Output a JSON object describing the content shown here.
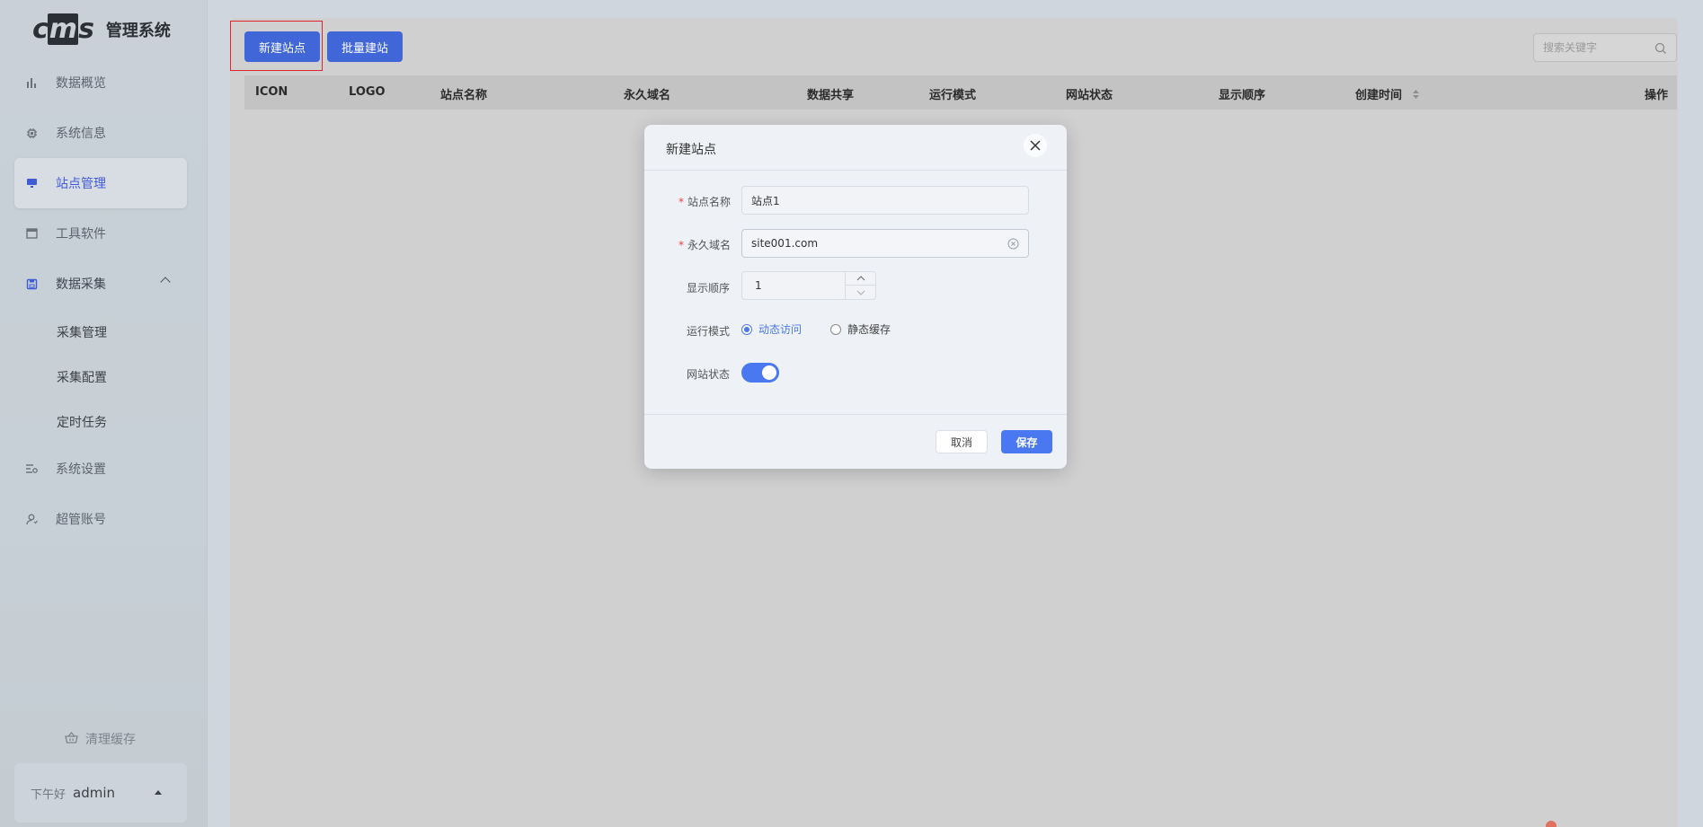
{
  "app": {
    "logo_text": "cms",
    "title": "管理系统"
  },
  "sidebar": {
    "items": [
      {
        "label": "数据概览",
        "icon": "bar-chart-icon"
      },
      {
        "label": "系统信息",
        "icon": "chip-icon"
      },
      {
        "label": "站点管理",
        "icon": "monitor-icon",
        "active": true
      },
      {
        "label": "工具软件",
        "icon": "window-icon"
      },
      {
        "label": "数据采集",
        "icon": "save-icon",
        "expanded": true
      }
    ],
    "sub_items": [
      "采集管理",
      "采集配置",
      "定时任务"
    ],
    "bottom_items": [
      {
        "label": "系统设置",
        "icon": "settings-list-icon"
      },
      {
        "label": "超管账号",
        "icon": "user-icon"
      }
    ],
    "clear_cache": "清理缓存",
    "greeting": "下午好",
    "username": "admin"
  },
  "toolbar": {
    "new_site": "新建站点",
    "batch_create": "批量建站",
    "search_placeholder": "搜索关键字"
  },
  "table": {
    "columns": [
      "ICON",
      "LOGO",
      "站点名称",
      "永久域名",
      "数据共享",
      "运行模式",
      "网站状态",
      "显示顺序",
      "创建时间",
      "操作"
    ]
  },
  "modal": {
    "title": "新建站点",
    "fields": {
      "site_name_label": "站点名称",
      "site_name_value": "站点1",
      "domain_label": "永久域名",
      "domain_value": "site001.com",
      "order_label": "显示顺序",
      "order_value": "1",
      "mode_label": "运行模式",
      "mode_options": [
        "动态访问",
        "静态缓存"
      ],
      "mode_selected": "动态访问",
      "status_label": "网站状态",
      "status_on": true
    },
    "cancel": "取消",
    "save": "保存"
  },
  "colors": {
    "primary": "#4066d7",
    "accent": "#4a78f0",
    "required": "#e64545",
    "highlight": "#e0242f"
  }
}
